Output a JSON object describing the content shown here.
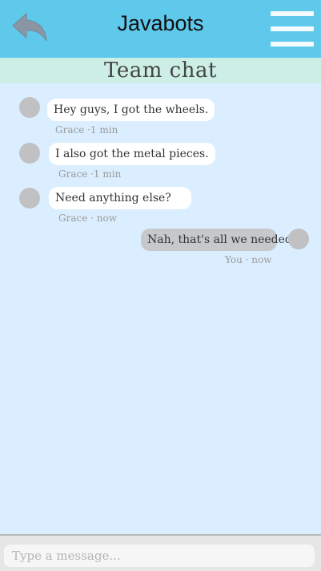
{
  "header": {
    "title": "Javabots",
    "back_icon": "back-arrow-icon",
    "menu_icon": "hamburger-menu-icon",
    "color": "#5ec9eb"
  },
  "chat": {
    "title": "Team chat",
    "messages": [
      {
        "text": "Hey guys, I got the wheels.",
        "meta": "Grace ·1 min",
        "direction": "incoming"
      },
      {
        "text": "I also got the metal pieces.",
        "meta": "Grace ·1 min",
        "direction": "incoming"
      },
      {
        "text": "Need anything else?",
        "meta": "Grace · now",
        "direction": "incoming"
      },
      {
        "text": "Nah, that's all we needed.",
        "meta": "You · now",
        "direction": "outgoing"
      }
    ]
  },
  "composer": {
    "placeholder": "Type a message..."
  }
}
